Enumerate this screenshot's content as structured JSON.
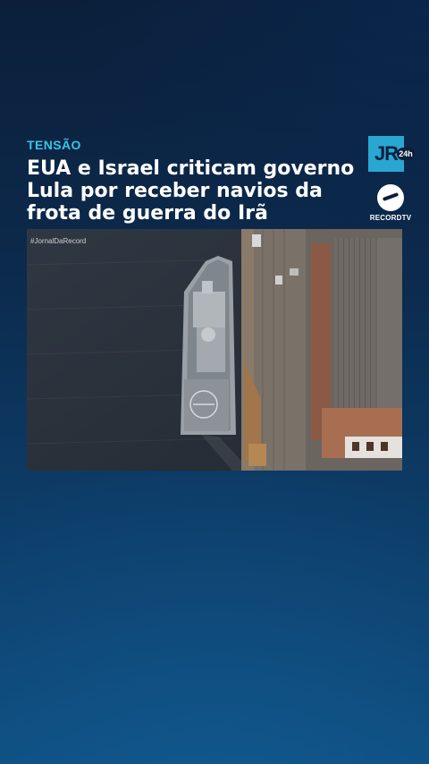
{
  "story": {
    "kicker": "TENSÃO",
    "headline": "EUA e Israel criticam governo Lula por receber navios da frota de guerra do Irã"
  },
  "logos": {
    "jr_text": "JR",
    "jr_badge": "24h",
    "record_text": "RECORDTV"
  },
  "video": {
    "hashtag": "#JornalDaRecord"
  },
  "colors": {
    "kicker": "#36c6e6",
    "background_top": "#0b1f3a",
    "background_bottom": "#0f4d7f"
  }
}
